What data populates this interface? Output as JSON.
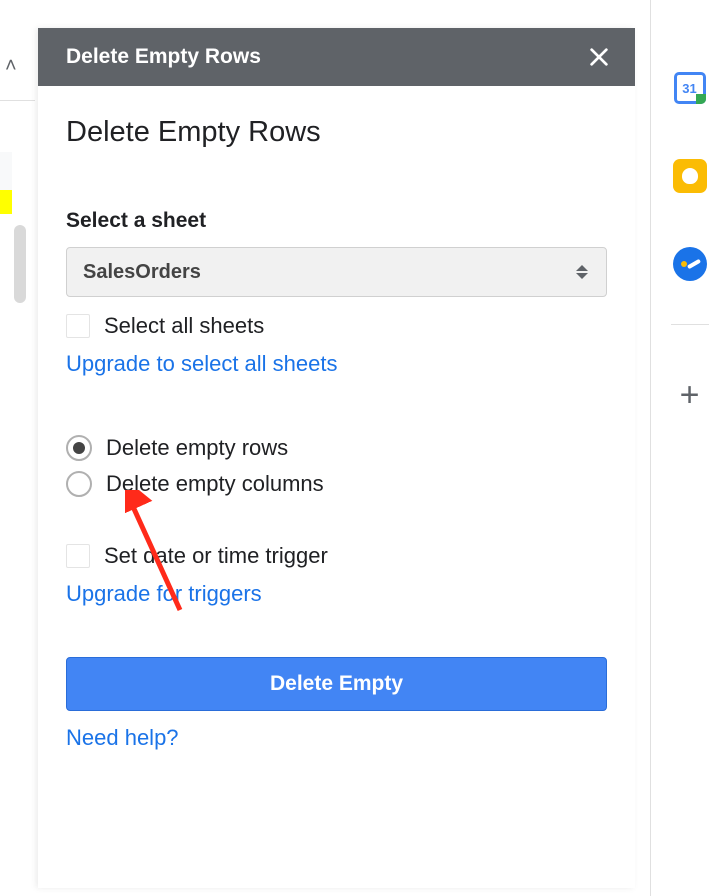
{
  "header": {
    "title": "Delete Empty Rows"
  },
  "main": {
    "title": "Delete Empty Rows",
    "select_sheet_label": "Select a sheet",
    "selected_sheet": "SalesOrders",
    "select_all_label": "Select all sheets",
    "upgrade_all_link": "Upgrade to select all sheets",
    "radio_rows": "Delete empty rows",
    "radio_cols": "Delete empty columns",
    "trigger_label": "Set date or time trigger",
    "upgrade_triggers_link": "Upgrade for triggers",
    "primary_button": "Delete Empty",
    "help_link": "Need help?"
  },
  "sidebar_icons": {
    "calendar_day": "31"
  }
}
